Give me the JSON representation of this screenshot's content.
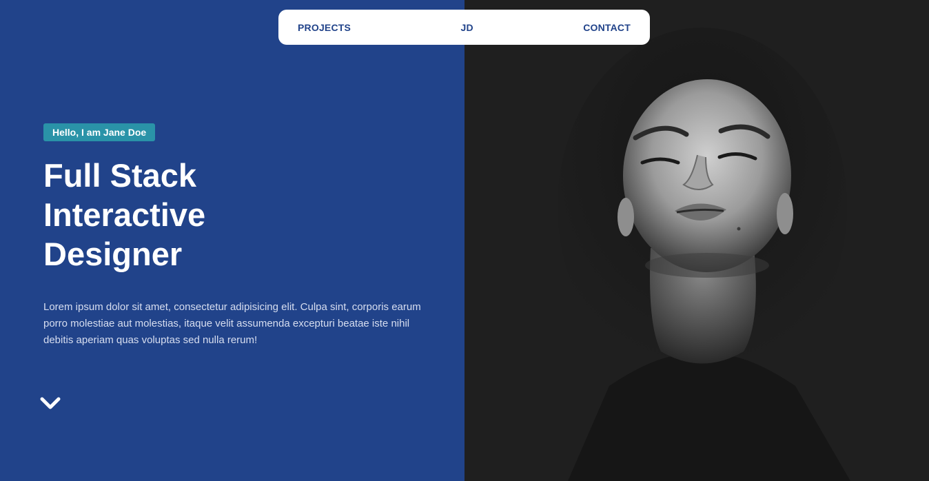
{
  "nav": {
    "projects_label": "PROJECTS",
    "logo_label": "JD",
    "contact_label": "CONTACT"
  },
  "hero": {
    "greeting": "Hello, I am Jane Doe",
    "title_lines": [
      "Full Stack",
      "Interactive",
      "Designer"
    ],
    "description": "Lorem ipsum dolor sit amet, consectetur adipisicing elit. Culpa sint, corporis earum porro molestiae aut molestias, itaque velit assumenda excepturi beatae iste nihil debitis aperiam quas voluptas sed nulla rerum!",
    "scroll_icon": "chevron-down-icon"
  },
  "colors": {
    "primary_blue": "#21438a",
    "badge_teal": "#2a93a8",
    "dark_panel": "#1f1f1f",
    "nav_background": "#ffffff"
  }
}
